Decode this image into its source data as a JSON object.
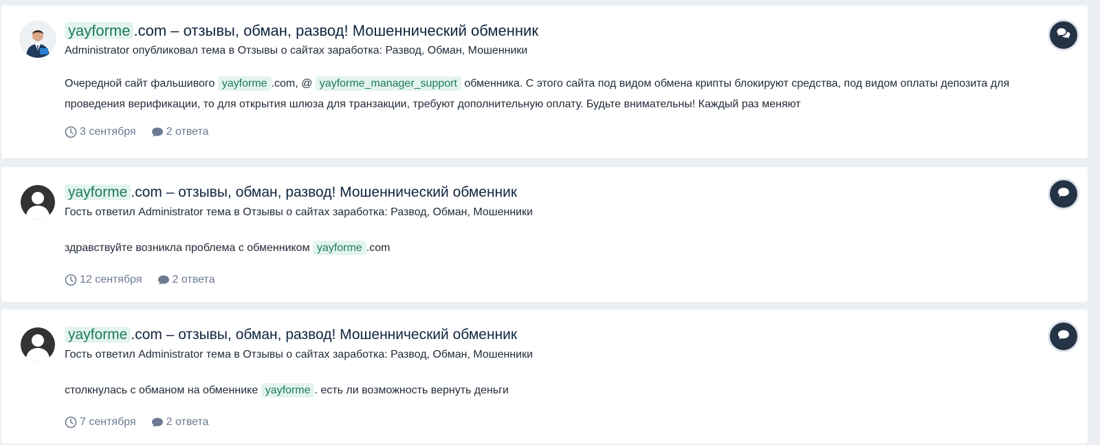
{
  "items": [
    {
      "title_highlight": "yayforme",
      "title_rest": ".com – отзывы, обман, развод! Мошеннический обменник",
      "meta": "Administrator опубликовал тема в Отзывы о сайтах заработка: Развод, Обман, Мошенники",
      "snippet": {
        "p1": "Очередной сайт фальшивого ",
        "hl1": "yayforme",
        "p2": ".com, @ ",
        "hl2": "yayforme_manager_support",
        "p3": " обменника. С этого сайта под видом обмена крипты блокируют средства, под видом оплаты депозита для проведения верификации, то для открытия шлюза для транзакции, требуют дополнительную оплату. Будьте внимательны! Каждый раз меняют"
      },
      "date": "3 сентября",
      "replies": "2 ответа",
      "avatar_icon": "admin-photo-avatar",
      "type_icon": "comments-icon"
    },
    {
      "title_highlight": "yayforme",
      "title_rest": ".com – отзывы, обман, развод! Мошеннический обменник",
      "meta": "Гость ответил Administrator тема в Отзывы о сайтах заработка: Развод, Обман, Мошенники",
      "snippet": {
        "p1": "здравствуйте возникла проблема с обменником ",
        "hl1": "yayforme",
        "p2": ".com"
      },
      "date": "12 сентября",
      "replies": "2 ответа",
      "avatar_icon": "guest-avatar",
      "type_icon": "comment-icon"
    },
    {
      "title_highlight": "yayforme",
      "title_rest": ".com – отзывы, обман, развод! Мошеннический обменник",
      "meta": "Гость ответил Administrator тема в Отзывы о сайтах заработка: Развод, Обман, Мошенники",
      "snippet": {
        "p1": "столкнулась с обманом на обменнике ",
        "hl1": "yayforme",
        "p2": ". есть ли возможность вернуть деньги"
      },
      "date": "7 сентября",
      "replies": "2 ответа",
      "avatar_icon": "guest-avatar",
      "type_icon": "comment-icon"
    }
  ],
  "colors": {
    "highlight_bg": "#e3f4ee",
    "highlight_text": "#1d7a5a",
    "title": "#10243e",
    "muted": "#6b7a90",
    "badge": "#253346",
    "page_bg": "#ebeef2"
  }
}
